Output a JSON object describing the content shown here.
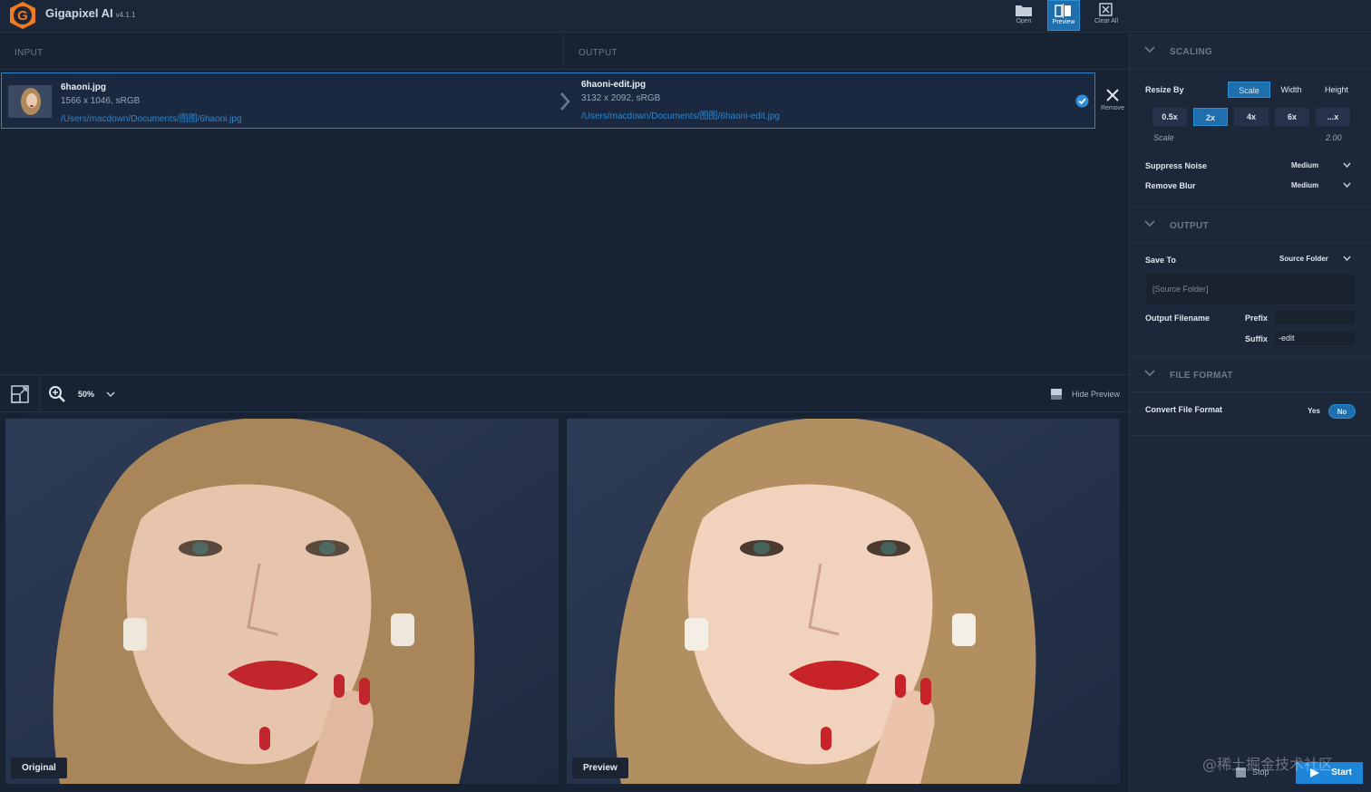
{
  "app": {
    "title": "Gigapixel AI",
    "version": "v4.1.1"
  },
  "toolbar": {
    "open": "Open",
    "preview": "Preview",
    "clear_all": "Clear All"
  },
  "columns": {
    "input": "INPUT",
    "output": "OUTPUT"
  },
  "file": {
    "input_name": "6haoni.jpg",
    "input_meta": "1566 x 1046, sRGB",
    "input_path": "/Users/macdown/Documents/图图/6haoni.jpg",
    "output_name": "6haoni-edit.jpg",
    "output_meta": "3132 x 2092, sRGB",
    "output_path": "/Users/macdown/Documents/图图/6haoni-edit.jpg",
    "remove": "Remove"
  },
  "preview_bar": {
    "zoom": "50%",
    "hide_preview": "Hide Preview"
  },
  "labels": {
    "original": "Original",
    "preview": "Preview"
  },
  "scaling": {
    "title": "SCALING",
    "resize_by": "Resize By",
    "modes": [
      "Scale",
      "Width",
      "Height"
    ],
    "scales": [
      "0.5x",
      "2x",
      "4x",
      "6x",
      "...x"
    ],
    "scale_label": "Scale",
    "scale_value": "2.00",
    "suppress_noise": "Suppress Noise",
    "suppress_noise_value": "Medium",
    "remove_blur": "Remove Blur",
    "remove_blur_value": "Medium"
  },
  "output": {
    "title": "OUTPUT",
    "save_to": "Save To",
    "save_to_value": "Source Folder",
    "folder_placeholder": "[Source Folder]",
    "output_filename": "Output Filename",
    "prefix": "Prefix",
    "prefix_value": "",
    "suffix": "Suffix",
    "suffix_value": "-edit"
  },
  "file_format": {
    "title": "FILE FORMAT",
    "convert": "Convert File Format",
    "yes": "Yes",
    "no": "No"
  },
  "actions": {
    "stop": "Stop",
    "start": "Start"
  },
  "watermark": "@稀土掘金技术社区",
  "colors": {
    "accent": "#1e6fae",
    "link": "#2b86d1",
    "bg": "#172233",
    "panel": "#1c2739"
  }
}
